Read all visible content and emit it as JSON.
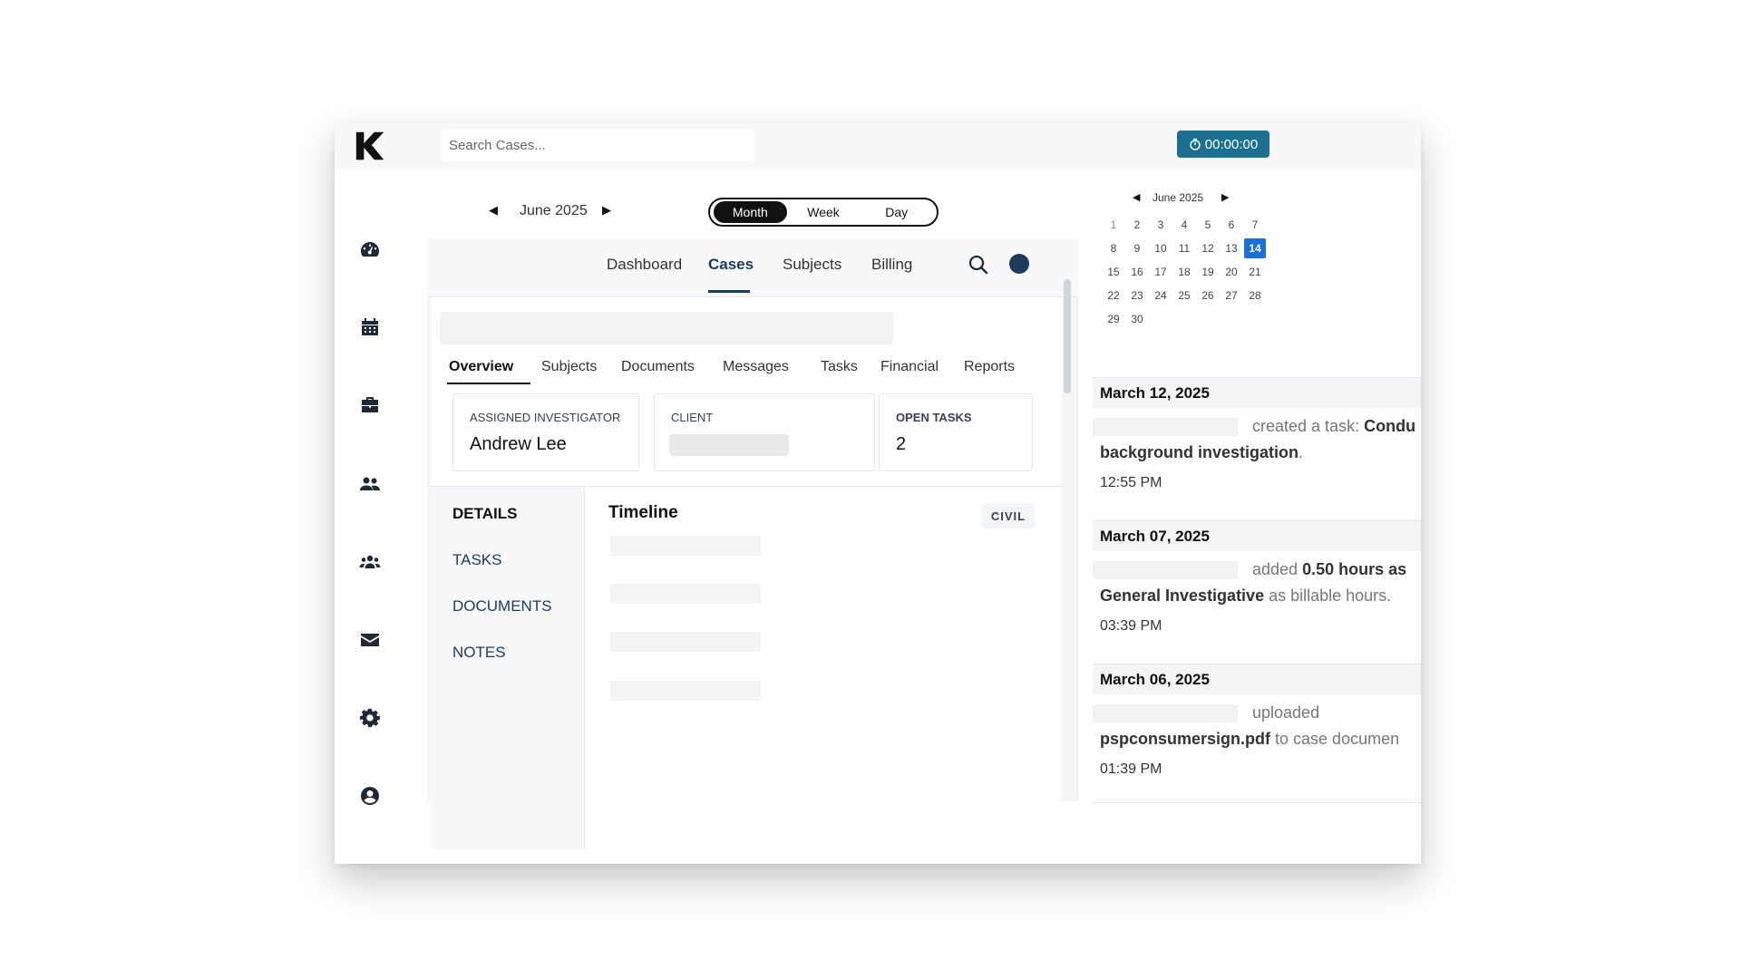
{
  "topbar": {
    "search_placeholder": "Search Cases...",
    "timer": "00:00:00"
  },
  "sidebar": {
    "icons": [
      "dashboard-icon",
      "calendar-icon",
      "briefcase-icon",
      "users-icon",
      "team-icon",
      "mail-icon",
      "gear-icon",
      "user-circle-icon",
      "logout-icon"
    ]
  },
  "calendar_bar": {
    "prev": "◀",
    "month": "June 2025",
    "next": "▶",
    "views": [
      "Month",
      "Week",
      "Day"
    ],
    "active_view": "Month"
  },
  "cases_nav": {
    "links": [
      "Dashboard",
      "Cases",
      "Subjects",
      "Billing"
    ],
    "active": "Cases"
  },
  "case": {
    "tabs": [
      "Overview",
      "Subjects",
      "Documents",
      "Messages",
      "Tasks",
      "Financial",
      "Reports"
    ],
    "active_tab": "Overview",
    "cards": {
      "investigator_label": "ASSIGNED INVESTIGATOR",
      "investigator_value": "Andrew Lee",
      "client_label": "CLIENT",
      "open_tasks_label": "OPEN TASKS",
      "open_tasks_value": "2"
    },
    "left_menu": [
      "DETAILS",
      "TASKS",
      "DOCUMENTS",
      "NOTES"
    ],
    "timeline_title": "Timeline",
    "case_type": "CIVIL"
  },
  "mini_calendar": {
    "prev": "◀",
    "title": "June 2025",
    "next": "▶",
    "today": 14,
    "days": [
      1,
      2,
      3,
      4,
      5,
      6,
      7,
      8,
      9,
      10,
      11,
      12,
      13,
      14,
      15,
      16,
      17,
      18,
      19,
      20,
      21,
      22,
      23,
      24,
      25,
      26,
      27,
      28,
      29,
      30
    ]
  },
  "feed": [
    {
      "date": "March 12, 2025",
      "line1_plain": "created a task: ",
      "line1_bold": "Condu",
      "line2_bold": "background investigation",
      "line2_plain": ".",
      "time": "12:55 PM"
    },
    {
      "date": "March 07, 2025",
      "line1_plain": "added ",
      "line1_bold": "0.50 hours as",
      "line2_bold": "General Investigative",
      "line2_plain": " as billable hours.",
      "time": "03:39 PM"
    },
    {
      "date": "March 06, 2025",
      "line1_plain": "uploaded",
      "line1_bold": "",
      "line2_bold": "pspconsumersign.pdf",
      "line2_plain": " to case documen",
      "time": "01:39 PM"
    }
  ]
}
